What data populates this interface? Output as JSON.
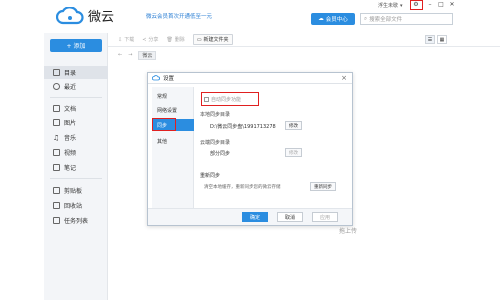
{
  "app": {
    "name": "微云",
    "promo": "微云会员首次开通低至一元",
    "vip_label": "会员中心"
  },
  "search": {
    "placeholder": "搜索全部文件"
  },
  "user": {
    "name": "浮生未歇"
  },
  "toolbar": {
    "download": "下载",
    "share": "分享",
    "delete": "删除",
    "new_folder": "新建文件夹"
  },
  "breadcrumb": {
    "current": "微云"
  },
  "sidebar": {
    "add_label": "+ 添加",
    "items": [
      {
        "label": "目录",
        "icon": "folder-icon"
      },
      {
        "label": "最近",
        "icon": "clock-icon"
      },
      {
        "label": "文档",
        "icon": "document-icon"
      },
      {
        "label": "图片",
        "icon": "image-icon"
      },
      {
        "label": "音乐",
        "icon": "music-icon"
      },
      {
        "label": "视频",
        "icon": "video-icon"
      },
      {
        "label": "笔记",
        "icon": "note-icon"
      },
      {
        "label": "剪贴板",
        "icon": "clipboard-icon"
      },
      {
        "label": "回收站",
        "icon": "recycle-icon"
      },
      {
        "label": "任务列表",
        "icon": "task-list-icon"
      }
    ]
  },
  "background": {
    "hint": "拖上传"
  },
  "dialog": {
    "title": "设置",
    "tabs": [
      "常规",
      "网络设置",
      "同步",
      "其他"
    ],
    "sync_toggle_label": "自动同步功能",
    "local_dir_label": "本地同步目录",
    "local_dir_value": "D:\\微云同步盘\\1991713278",
    "modify_label": "修改",
    "cloud_dir_label": "云端同步目录",
    "cloud_dir_value": "部分同步",
    "modify2_label": "修改",
    "resync_title": "重新同步",
    "resync_desc": "清空本地缓存，重新同步您的微云存储",
    "resync_button": "重新同步",
    "ok": "确定",
    "cancel": "取消",
    "apply": "应用"
  },
  "colors": {
    "accent": "#2b8de0",
    "highlight": "#e02020"
  }
}
